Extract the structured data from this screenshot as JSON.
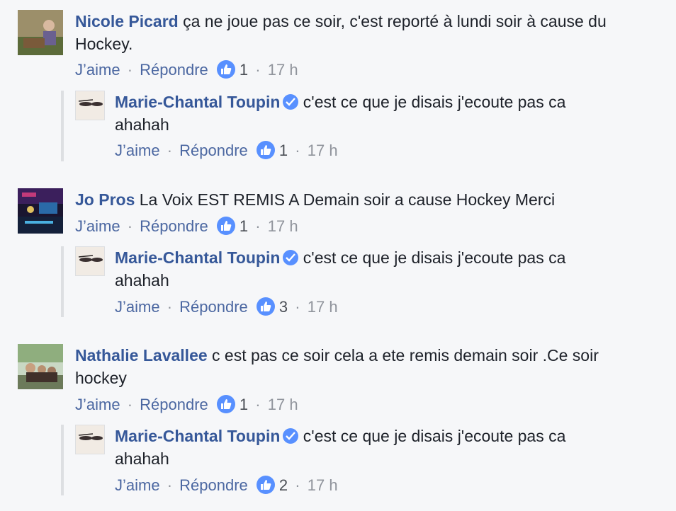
{
  "actions": {
    "like": "J’aime",
    "reply": "Répondre",
    "sep": "·"
  },
  "comments": [
    {
      "name": "Nicole Picard",
      "text_line1": "ça ne joue pas ce soir, c'est reporté à lundi soir à cause du",
      "text_line2": "Hockey.",
      "likes": "1",
      "time": "17 h",
      "reply": {
        "name": "Marie-Chantal Toupin",
        "text_line1": "c'est ce que je disais j'ecoute pas ca",
        "text_line2": "ahahah",
        "likes": "1",
        "time": "17 h"
      }
    },
    {
      "name": "Jo Pros",
      "text_line1": "La Voix EST REMIS A Demain soir a cause Hockey Merci",
      "likes": "1",
      "time": "17 h",
      "reply": {
        "name": "Marie-Chantal Toupin",
        "text_line1": "c'est ce que je disais j'ecoute pas ca",
        "text_line2": "ahahah",
        "likes": "3",
        "time": "17 h"
      }
    },
    {
      "name": "Nathalie Lavallee",
      "text_line1": "c est pas ce soir cela a ete remis demain soir .Ce soir",
      "text_line2": "hockey",
      "likes": "1",
      "time": "17 h",
      "reply": {
        "name": "Marie-Chantal Toupin",
        "text_line1": "c'est ce que je disais j'ecoute pas ca",
        "text_line2": "ahahah",
        "likes": "2",
        "time": "17 h"
      }
    }
  ]
}
